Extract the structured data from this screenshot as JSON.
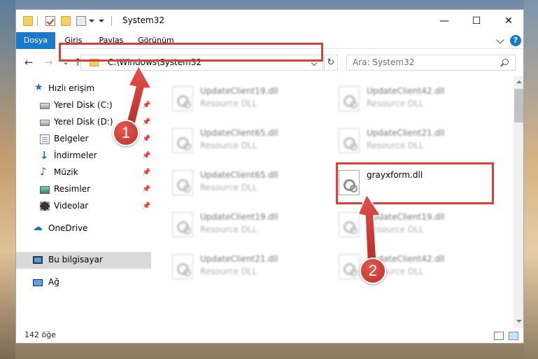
{
  "window": {
    "title": "System32",
    "controls": {
      "minimize": "—",
      "maximize": "☐",
      "close": "✕"
    }
  },
  "ribbon": {
    "tabs": [
      "Dosya",
      "Giriş",
      "Paylaş",
      "Görünüm"
    ],
    "help": "?"
  },
  "nav": {
    "back": "←",
    "forward": "→",
    "recent": "⌄",
    "up": "↑",
    "address": "C:\\Windows\\System32",
    "refresh": "↻",
    "search_placeholder": "Ara: System32"
  },
  "sidebar": {
    "items": [
      {
        "label": "Hızlı erişim",
        "icon": "star-icon",
        "pinned": false
      },
      {
        "label": "Yerel Disk (C:)",
        "icon": "disk-icon",
        "pinned": true
      },
      {
        "label": "Yerel Disk (D:)",
        "icon": "disk-icon",
        "pinned": true
      },
      {
        "label": "Belgeler",
        "icon": "documents-icon",
        "pinned": true
      },
      {
        "label": "İndirmeler",
        "icon": "download-icon",
        "pinned": true
      },
      {
        "label": "Müzik",
        "icon": "music-icon",
        "pinned": true
      },
      {
        "label": "Resimler",
        "icon": "pictures-icon",
        "pinned": true
      },
      {
        "label": "Videolar",
        "icon": "videos-icon",
        "pinned": true
      },
      {
        "label": "OneDrive",
        "icon": "onedrive-icon",
        "pinned": false
      },
      {
        "label": "Bu bilgisayar",
        "icon": "computer-icon",
        "pinned": false,
        "selected": true
      },
      {
        "label": "Ağ",
        "icon": "network-icon",
        "pinned": false
      }
    ],
    "pin_glyph": "📌"
  },
  "files": [
    {
      "name": "UpdateClient19.dll",
      "type": "Resource DLL"
    },
    {
      "name": "UpdateClient42.dll",
      "type": "Resource DLL"
    },
    {
      "name": "UpdateClient65.dll",
      "type": "Resource DLL"
    },
    {
      "name": "UpdateClient21.dll",
      "type": "Resource DLL"
    },
    {
      "name": "UpdateClient65.dll",
      "type": "Resource DLL"
    },
    {
      "name": "grayxform.dll",
      "type": ""
    },
    {
      "name": "UpdateClient19.dll",
      "type": "Resource DLL"
    },
    {
      "name": "UpdateClient19.dll",
      "type": "Resource DLL"
    },
    {
      "name": "UpdateClient21.dll",
      "type": "Resource DLL"
    },
    {
      "name": "UpdateClient42.dll",
      "type": "Resource DLL"
    }
  ],
  "status": {
    "item_count": "142 öğe"
  },
  "annotations": {
    "step1": "1",
    "step2": "2",
    "highlight_color": "#d8413a"
  },
  "colors": {
    "accent": "#1979ca",
    "selection": "#d9d9d9"
  }
}
